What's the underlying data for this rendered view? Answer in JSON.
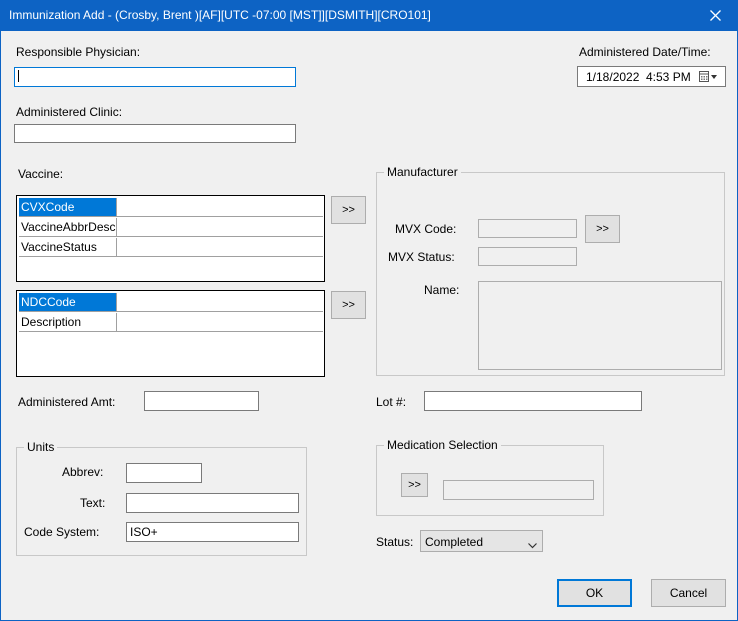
{
  "window": {
    "title": "Immunization Add  - (Crosby, Brent )[AF][UTC -07:00 [MST]][DSMITH][CRO101]",
    "close_icon": "close-icon"
  },
  "physician": {
    "label": "Responsible Physician:",
    "value": ""
  },
  "clinic": {
    "label": "Administered Clinic:",
    "value": ""
  },
  "administered": {
    "label": "Administered Date/Time:",
    "date": "1/18/2022",
    "time": "4:53 PM",
    "icon": "calendar-icon"
  },
  "vaccine": {
    "label": "Vaccine:",
    "rows": [
      {
        "name": "CVXCode",
        "value": ""
      },
      {
        "name": "VaccineAbbrDesc",
        "value": ""
      },
      {
        "name": "VaccineStatus",
        "value": ""
      }
    ],
    "ndc_rows": [
      {
        "name": "NDCCode",
        "value": ""
      },
      {
        "name": "Description",
        "value": ""
      }
    ],
    "browse_label": ">>"
  },
  "manufacturer": {
    "legend": "Manufacturer",
    "mvx_code_label": "MVX Code:",
    "mvx_code": "",
    "mvx_status_label": "MVX Status:",
    "mvx_status": "",
    "name_label": "Name:",
    "name": "",
    "browse_label": ">>"
  },
  "amount": {
    "label": "Administered Amt:",
    "value": ""
  },
  "lot": {
    "label": "Lot #:",
    "value": ""
  },
  "units": {
    "legend": "Units",
    "abbrev_label": "Abbrev:",
    "abbrev": "",
    "text_label": "Text:",
    "text": "",
    "code_system_label": "Code System:",
    "code_system": "ISO+"
  },
  "medication": {
    "legend": "Medication Selection",
    "browse_label": ">>",
    "value": ""
  },
  "status": {
    "label": "Status:",
    "value": "Completed"
  },
  "buttons": {
    "ok": "OK",
    "cancel": "Cancel"
  }
}
